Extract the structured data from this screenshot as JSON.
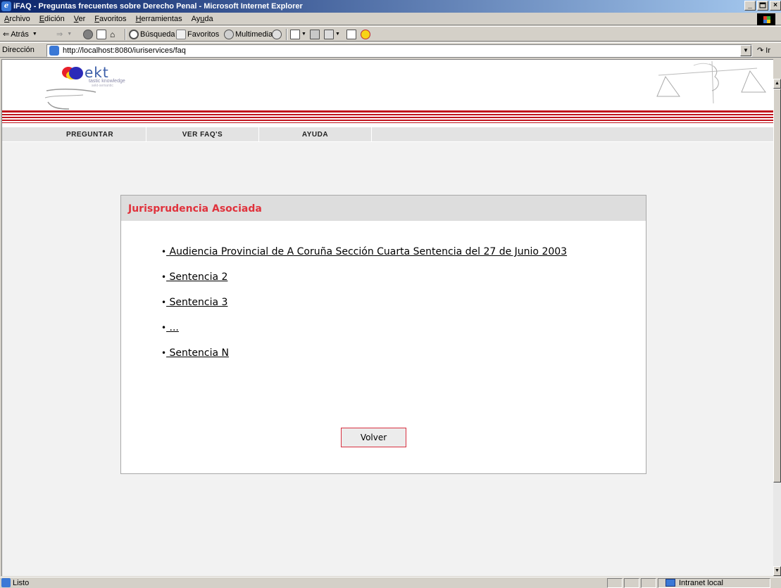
{
  "window": {
    "title": "iFAQ - Preguntas frecuentes sobre Derecho Penal - Microsoft Internet Explorer",
    "controls": [
      "_",
      "×"
    ]
  },
  "menu": {
    "items": [
      {
        "acc": "A",
        "rest": "rchivo"
      },
      {
        "acc": "E",
        "rest": "dición"
      },
      {
        "acc": "V",
        "rest": "er"
      },
      {
        "acc": "F",
        "rest": "avoritos"
      },
      {
        "acc": "H",
        "rest": "erramientas"
      },
      {
        "pre": "Ay",
        "acc": "u",
        "rest": "da"
      }
    ]
  },
  "toolbar": {
    "back": "Atrás",
    "search": "Búsqueda",
    "favorites": "Favoritos",
    "media": "Multimedia"
  },
  "address": {
    "label": "Dirección",
    "url": "http://localhost:8080/iuriservices/faq",
    "go": "Ir"
  },
  "logo": {
    "name": "ekt",
    "sub1": "tastic knowledge",
    "sub2": "sekt-semantic"
  },
  "nav": {
    "items": [
      "PREGUNTAR",
      "VER FAQ'S",
      "AYUDA"
    ]
  },
  "panel": {
    "title": "Jurisprudencia Asociada",
    "bullet": "•",
    "links": [
      " Audiencia Provincial de A Coruña Sección Cuarta Sentencia del 27 de Junio 2003",
      " Sentencia 2",
      " Sentencia 3",
      " ...",
      " Sentencia N"
    ],
    "back_button": "Volver"
  },
  "status": {
    "text": "Listo",
    "zone": "Intranet local"
  },
  "colors": {
    "title_bar_start": "#0a246a",
    "accent_red": "#c0141e",
    "panel_title": "#e0323c"
  }
}
